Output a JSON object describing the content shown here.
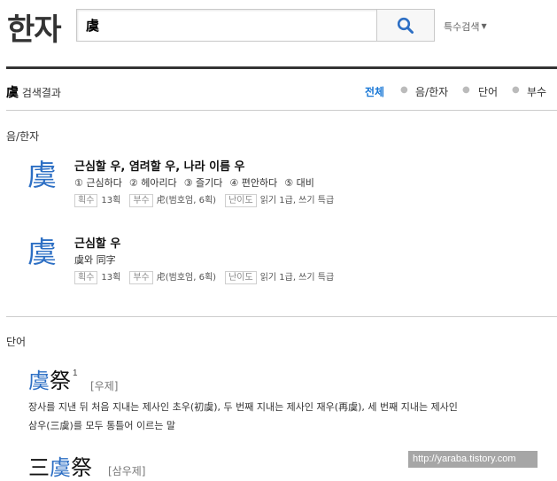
{
  "header": {
    "logo": "한자",
    "search_value": "虞",
    "special_search": "특수검색",
    "accent": "#1a78d6",
    "search_icon": "search-icon"
  },
  "result": {
    "query": "虞",
    "title_suffix": " 검색결과"
  },
  "tabs": [
    {
      "label": "전체",
      "active": true
    },
    {
      "label": "음/한자",
      "active": false
    },
    {
      "label": "단어",
      "active": false
    },
    {
      "label": "부수",
      "active": false
    }
  ],
  "hanja_section": {
    "label": "음/한자",
    "entries": [
      {
        "char": "虞",
        "meaning": "근심할 우, 염려할 우, 나라 이름 우",
        "senses": [
          "① 근심하다",
          "② 헤아리다",
          "③ 즐기다",
          "④ 편안하다",
          "⑤ 대비"
        ],
        "stroke_label": "획수",
        "stroke": "13획",
        "radical_label": "부수",
        "radical": "虍(범호엄, 6획)",
        "level_label": "난이도",
        "level": "읽기 1급, 쓰기 특급"
      },
      {
        "char": "虞",
        "meaning": "근심할 우",
        "senses": [
          "虞와 同字"
        ],
        "stroke_label": "획수",
        "stroke": "13획",
        "radical_label": "부수",
        "radical": "虍(범호엄, 6획)",
        "level_label": "난이도",
        "level": "읽기 1급, 쓰기 특급"
      }
    ]
  },
  "word_section": {
    "label": "단어",
    "words": [
      {
        "pre": "",
        "hl": "虞",
        "post": "祭",
        "sup": "1",
        "reading": "[우제]",
        "definition_line1": "장사를 지낸 뒤 처음 지내는 제사인 초우(初虞), 두 번째 지내는 제사인 재우(再虞), 세 번째 지내는 제사인",
        "definition_line2": "삼우(三虞)를 모두 통틀어 이르는 말"
      },
      {
        "pre": "三",
        "hl": "虞",
        "post": "祭",
        "sup": "",
        "reading": "[삼우제]"
      }
    ]
  },
  "watermark": "http://yaraba.tistory.com"
}
